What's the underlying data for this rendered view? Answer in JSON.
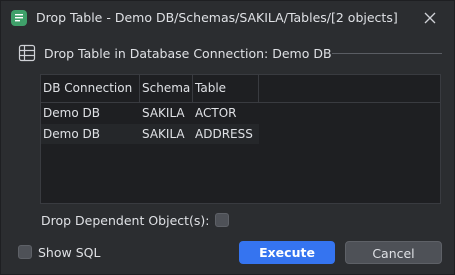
{
  "window": {
    "title": "Drop Table - Demo DB/Schemas/SAKILA/Tables/[2 objects]",
    "app_icon": "database-sql-icon",
    "close_icon": "close-icon"
  },
  "section": {
    "icon": "table-icon",
    "title": "Drop Table in Database Connection: Demo DB"
  },
  "table": {
    "columns": [
      "DB Connection",
      "Schema",
      "Table"
    ],
    "rows": [
      [
        "Demo DB",
        "SAKILA",
        "ACTOR"
      ],
      [
        "Demo DB",
        "SAKILA",
        "ADDRESS"
      ]
    ]
  },
  "options": {
    "drop_dependent_label": "Drop Dependent Object(s):",
    "drop_dependent_checked": false,
    "show_sql_label": "Show SQL",
    "show_sql_checked": false
  },
  "buttons": {
    "execute": "Execute",
    "cancel": "Cancel"
  },
  "colors": {
    "background": "#2b2d30",
    "grid_background": "#1e1f22",
    "accent": "#3574f0",
    "app_icon": "#3fa06a"
  }
}
